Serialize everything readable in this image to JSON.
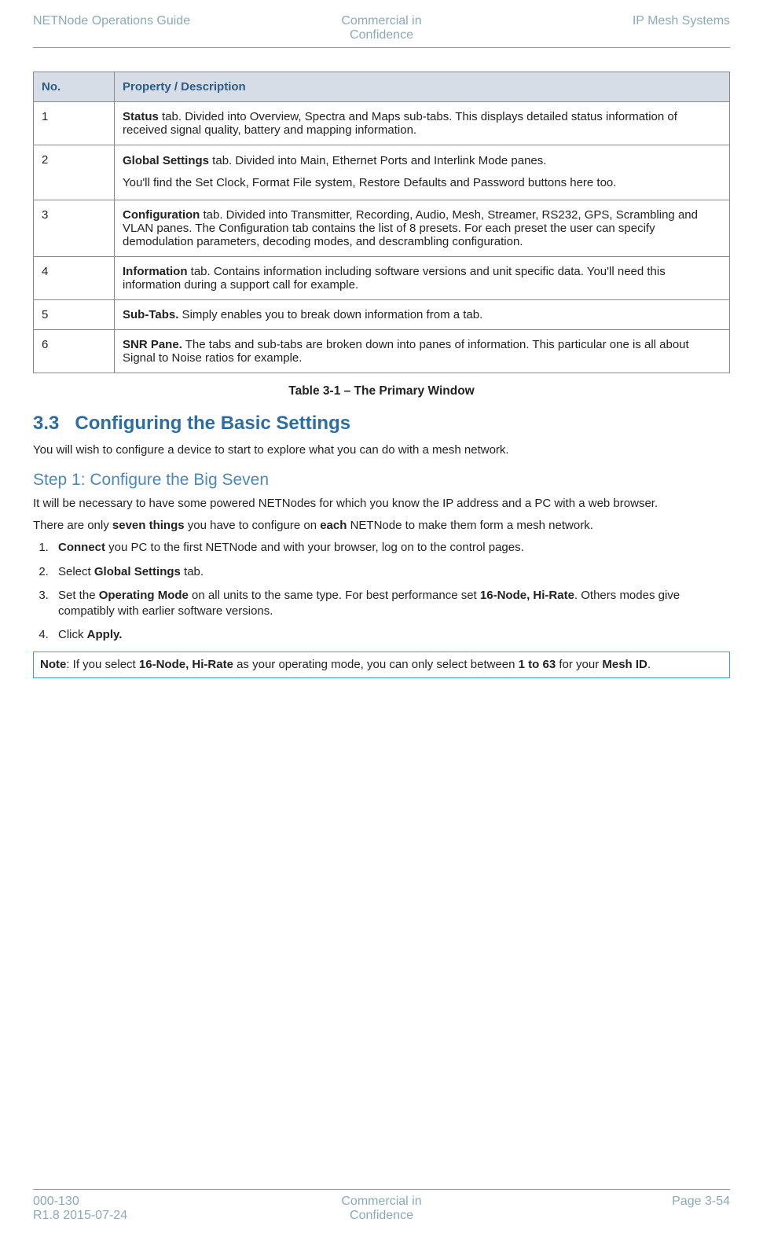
{
  "header": {
    "left": "NETNode Operations Guide",
    "center_line1": "Commercial in",
    "center_line2": "Confidence",
    "right": "IP Mesh Systems"
  },
  "table": {
    "headers": {
      "no": "No.",
      "desc": "Property / Description"
    },
    "rows": [
      {
        "no": "1",
        "bold": "Status",
        "after_bold": " tab. Divided into Overview, Spectra and Maps sub-tabs. This displays detailed status information of received signal quality, battery and mapping information."
      },
      {
        "no": "2",
        "bold": "Global Settings",
        "after_bold": " tab. Divided into Main, Ethernet Ports and Interlink Mode panes.",
        "para2": "You'll find the Set Clock, Format File system, Restore Defaults and Password buttons here too."
      },
      {
        "no": "3",
        "bold": "Configuration",
        "after_bold": " tab. Divided into Transmitter, Recording, Audio, Mesh, Streamer, RS232, GPS, Scrambling and VLAN panes. The Configuration tab contains the list of 8 presets. For each preset the user can specify demodulation parameters, decoding modes, and descrambling configuration."
      },
      {
        "no": "4",
        "bold": "Information",
        "after_bold": " tab. Contains information including software versions and unit specific data. You'll need this information during a support call for example."
      },
      {
        "no": "5",
        "bold": "Sub-Tabs.",
        "after_bold": " Simply enables you to break down information from a tab."
      },
      {
        "no": "6",
        "bold": "SNR Pane.",
        "after_bold": " The tabs and sub-tabs are broken down into panes of information. This particular one is all about Signal to Noise ratios for example."
      }
    ],
    "caption": "Table 3-1 – The Primary Window"
  },
  "section": {
    "number": "3.3",
    "title": "Configuring the Basic Settings",
    "intro": "You will wish to configure a device to start to explore what you can do with a mesh network.",
    "step_heading": "Step 1: Configure the Big Seven",
    "p1": "It will be necessary to have some powered NETNodes for which you know the IP address and a PC with a web browser.",
    "p2_pre": "There are only ",
    "p2_b1": "seven things",
    "p2_mid": " you have to configure on ",
    "p2_b2": "each",
    "p2_post": " NETNode to make them form a mesh network.",
    "steps": {
      "s1_b": "Connect",
      "s1_rest": " you PC to the first NETNode and with your browser, log on to the control pages.",
      "s2_pre": "Select ",
      "s2_b": "Global Settings",
      "s2_post": " tab.",
      "s3_pre": "Set the ",
      "s3_b1": "Operating Mode",
      "s3_mid": " on all units to the same type. For best performance set ",
      "s3_b2": "16-Node, Hi-Rate",
      "s3_post": ". Others modes give compatibly with earlier software versions.",
      "s4_pre": "Click ",
      "s4_b": "Apply."
    },
    "note": {
      "label": "Note",
      "pre": ":  If you select ",
      "b1": "16-Node, Hi-Rate",
      "mid": " as your operating mode, you can only select between ",
      "b2": "1 to 63",
      "mid2": " for your ",
      "b3": "Mesh ID",
      "post": "."
    }
  },
  "footer": {
    "left_line1": "000-130",
    "left_line2": "R1.8 2015-07-24",
    "center_line1": "Commercial in",
    "center_line2": "Confidence",
    "right": "Page 3-54"
  }
}
